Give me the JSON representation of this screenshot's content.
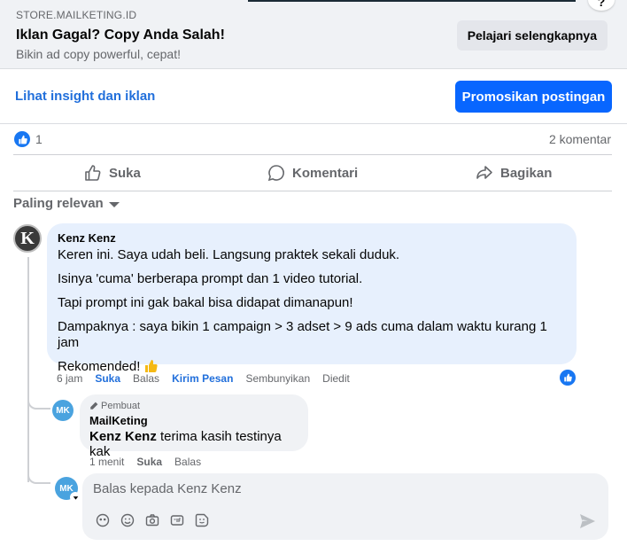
{
  "ad": {
    "domain": "STORE.MAILKETING.ID",
    "title": "Iklan Gagal? Copy Anda Salah!",
    "subtitle": "Bikin ad copy powerful, cepat!",
    "cta": "Pelajari selengkapnya",
    "corner": "?"
  },
  "toolbar": {
    "insight_link": "Lihat insight dan iklan",
    "promote": "Promosikan postingan"
  },
  "reactions": {
    "like_count": "1",
    "comment_count": "2 komentar"
  },
  "actions": {
    "like": "Suka",
    "comment": "Komentari",
    "share": "Bagikan"
  },
  "sort": {
    "label": "Paling relevan"
  },
  "comment": {
    "avatar_letter": "K",
    "author": "Kenz Kenz",
    "lines": [
      "Keren ini. Saya udah beli. Langsung praktek sekali duduk.",
      "Isinya 'cuma' berberapa prompt dan 1 video tutorial.",
      "Tapi prompt ini gak bakal bisa didapat dimanapun!",
      "Dampaknya : saya bikin 1 campaign > 3 adset > 9 ads cuma dalam waktu kurang 1 jam",
      "Rekomended!"
    ],
    "meta": {
      "time": "6 jam",
      "like": "Suka",
      "reply": "Balas",
      "message": "Kirim Pesan",
      "hide": "Sembunyikan",
      "edited": "Diedit"
    }
  },
  "reply": {
    "avatar_text": "MK",
    "creator_badge": "Pembuat",
    "author": "MailKeting",
    "mention": "Kenz Kenz",
    "text": " terima kasih testinya kak",
    "meta": {
      "time": "1 menit",
      "like": "Suka",
      "reply": "Balas"
    }
  },
  "composer": {
    "avatar_text": "MK",
    "placeholder": "Balas kepada Kenz Kenz",
    "tools": [
      "avatar-sticker-icon",
      "emoji-icon",
      "camera-icon",
      "gif-icon",
      "sticker-icon"
    ]
  },
  "colors": {
    "primary": "#0866ff",
    "link": "#216fdb",
    "comment_bubble": "#e7f0fd",
    "secondary_text": "#65676b"
  }
}
